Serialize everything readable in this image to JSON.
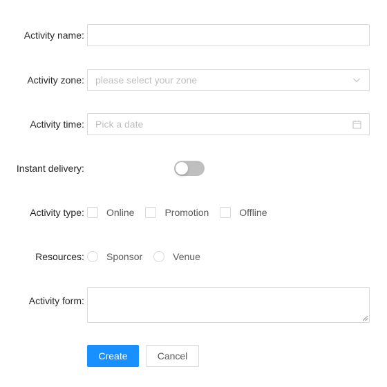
{
  "form": {
    "name": {
      "label": "Activity name",
      "value": ""
    },
    "zone": {
      "label": "Activity zone",
      "placeholder": "please select your zone",
      "icon": "chevron-down-icon"
    },
    "time": {
      "label": "Activity time",
      "placeholder": "Pick a date",
      "icon": "calendar-icon"
    },
    "delivery": {
      "label": "Instant delivery",
      "checked": false
    },
    "type": {
      "label": "Activity type",
      "options": [
        "Online",
        "Promotion",
        "Offline"
      ]
    },
    "resources": {
      "label": "Resources",
      "options": [
        "Sponsor",
        "Venue"
      ]
    },
    "activity_form": {
      "label": "Activity form",
      "value": ""
    },
    "colon": ":",
    "buttons": {
      "create": "Create",
      "cancel": "Cancel"
    }
  },
  "colors": {
    "primary": "#1890ff",
    "border": "#d9d9d9",
    "placeholder": "#bfbfbf",
    "switch_off": "#bfbfbf"
  }
}
